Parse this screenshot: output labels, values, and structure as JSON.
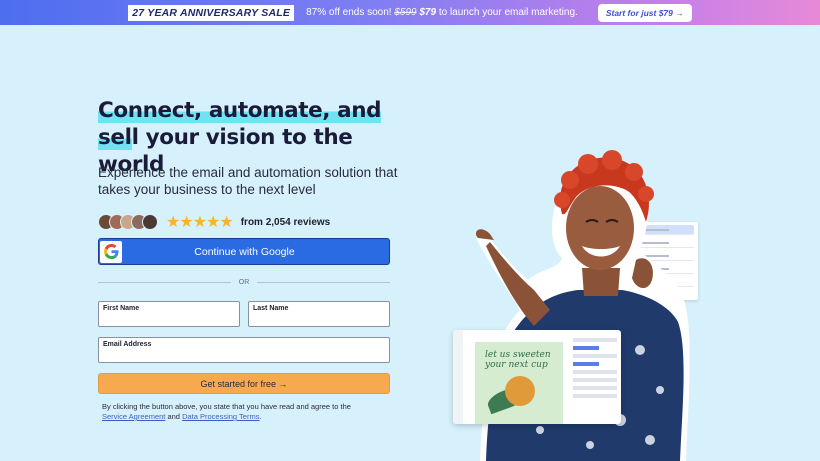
{
  "banner": {
    "sale_tag": "27 YEAR ANNIVERSARY SALE",
    "msg_prefix": "87% off ends soon!",
    "old_price": "$599",
    "new_price": "$79",
    "msg_suffix": "to launch your email marketing.",
    "cta": "Start for just $79 →"
  },
  "hero": {
    "headline_hl1": "Connect, automate, and",
    "headline_hl2": "sel",
    "headline_rest": "l your vision to the world",
    "subhead": "Experience the email and automation solution that takes your business to the next level",
    "reviews_text": "from 2,054 reviews",
    "rating": 5,
    "stars": "★★★★★"
  },
  "form": {
    "google_label": "Continue with Google",
    "or_label": "OR",
    "first_name_label": "First Name",
    "last_name_label": "Last Name",
    "email_label": "Email Address",
    "submit_label": "Get started for free →",
    "legal_prefix": "By clicking the button above, you state that you have read and agree to the",
    "service_agreement": "Service Agreement",
    "legal_and": "and",
    "data_processing": "Data Processing Terms",
    "legal_end": "."
  },
  "visual": {
    "card_text": "let us sweeten your next cup"
  },
  "colors": {
    "background": "#d6f1fb",
    "google_button": "#2a6ae3",
    "submit_button": "#f7a94f",
    "headline_highlight": "#6fe3f2",
    "star": "#f7b529"
  }
}
